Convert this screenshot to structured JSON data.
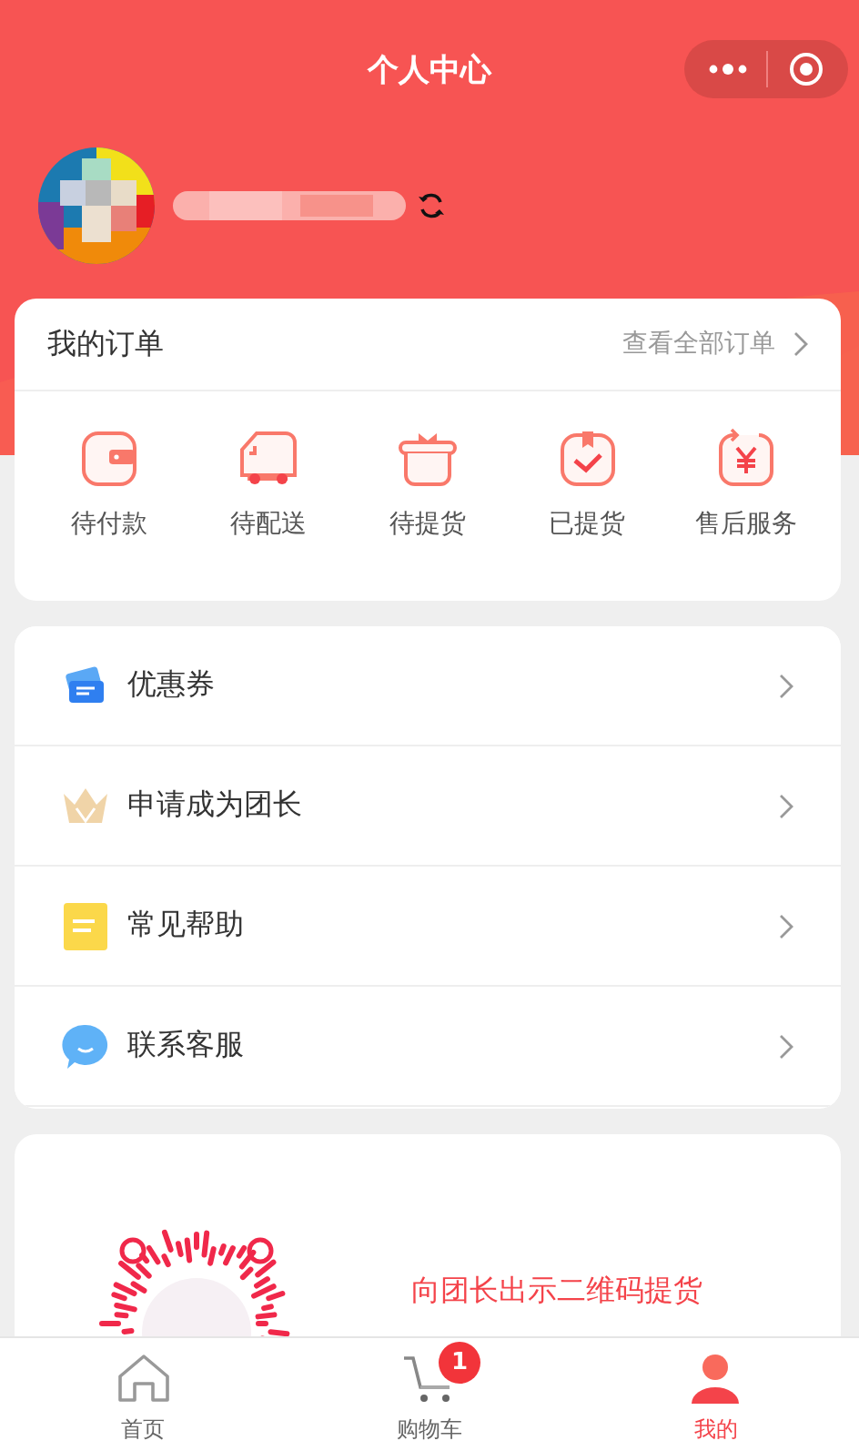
{
  "nav_bar": {
    "title": "个人中心"
  },
  "orders": {
    "title": "我的订单",
    "view_all": "查看全部订单",
    "statuses": [
      {
        "label": "待付款",
        "kind": "wallet"
      },
      {
        "label": "待配送",
        "kind": "truck"
      },
      {
        "label": "待提货",
        "kind": "gift"
      },
      {
        "label": "已提货",
        "kind": "check"
      },
      {
        "label": "售后服务",
        "kind": "yen"
      }
    ]
  },
  "menu": [
    {
      "label": "优惠券",
      "kind": "coupon"
    },
    {
      "label": "申请成为团长",
      "kind": "crown"
    },
    {
      "label": "常见帮助",
      "kind": "note"
    },
    {
      "label": "联系客服",
      "kind": "chat"
    }
  ],
  "pickup": {
    "hint": "向团长出示二维码提货"
  },
  "tab_bar": [
    {
      "label": "首页",
      "kind": "home",
      "selected": false
    },
    {
      "label": "购物车",
      "kind": "cart",
      "selected": false,
      "badge": "1"
    },
    {
      "label": "我的",
      "kind": "user",
      "selected": true
    }
  ]
}
